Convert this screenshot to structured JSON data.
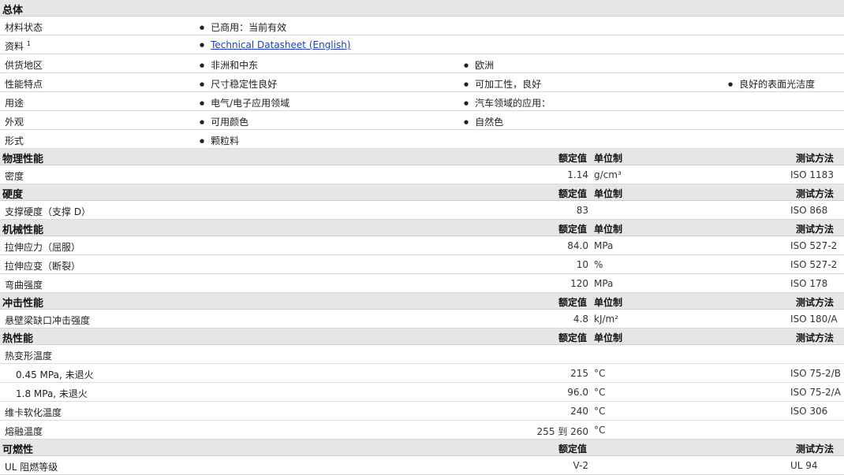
{
  "general": {
    "title": "总体",
    "rows": [
      {
        "label": "材料状态",
        "items": [
          "已商用：当前有效"
        ]
      },
      {
        "label": "资料",
        "sup": "1",
        "link": "Technical Datasheet (English)"
      },
      {
        "label": "供货地区",
        "items": [
          "非洲和中东",
          "欧洲"
        ]
      },
      {
        "label": "性能特点",
        "items": [
          "尺寸稳定性良好",
          "可加工性，良好",
          "良好的表面光洁度"
        ]
      },
      {
        "label": "用途",
        "items": [
          "电气/电子应用领域",
          "汽车领域的应用："
        ]
      },
      {
        "label": "外观",
        "items": [
          "可用颜色",
          "自然色"
        ]
      },
      {
        "label": "形式",
        "items": [
          "颗粒料"
        ]
      }
    ]
  },
  "columns": {
    "value": "额定值",
    "unit": "单位制",
    "test": "测试方法"
  },
  "sections": [
    {
      "title": "物理性能",
      "rows": [
        {
          "label": "密度",
          "value": "1.14",
          "unit": "g/cm³",
          "test": "ISO 1183"
        }
      ]
    },
    {
      "title": "硬度",
      "rows": [
        {
          "label": "支撑硬度（支撑 D）",
          "value": "83",
          "unit": "",
          "test": "ISO 868"
        }
      ]
    },
    {
      "title": "机械性能",
      "rows": [
        {
          "label": "拉伸应力（屈服）",
          "value": "84.0",
          "unit": "MPa",
          "test": "ISO 527-2"
        },
        {
          "label": "拉伸应变（断裂）",
          "value": "10",
          "unit": "%",
          "test": "ISO 527-2"
        },
        {
          "label": "弯曲强度",
          "value": "120",
          "unit": "MPa",
          "test": "ISO 178"
        }
      ]
    },
    {
      "title": "冲击性能",
      "rows": [
        {
          "label": "悬壁梁缺口冲击强度",
          "value": "4.8",
          "unit": "kJ/m²",
          "test": "ISO 180/A"
        }
      ]
    },
    {
      "title": "热性能",
      "rows": [
        {
          "label": "热变形温度",
          "value": "",
          "unit": "",
          "test": ""
        },
        {
          "label": "0.45 MPa, 未退火",
          "sub": true,
          "value": "215",
          "unit": "°C",
          "test": "ISO 75-2/B"
        },
        {
          "label": "1.8 MPa, 未退火",
          "sub": true,
          "value": "96.0",
          "unit": "°C",
          "test": "ISO 75-2/A"
        },
        {
          "label": "维卡软化温度",
          "value": "240",
          "unit": "°C",
          "test": "ISO 306"
        },
        {
          "label": "熔融温度",
          "value": "255 到  260",
          "unit": "°C",
          "test": ""
        }
      ]
    },
    {
      "title": "可燃性",
      "hide_unit": true,
      "rows": [
        {
          "label": "UL 阻燃等级",
          "value": "V-2",
          "unit": "",
          "test": "UL 94"
        }
      ]
    }
  ]
}
